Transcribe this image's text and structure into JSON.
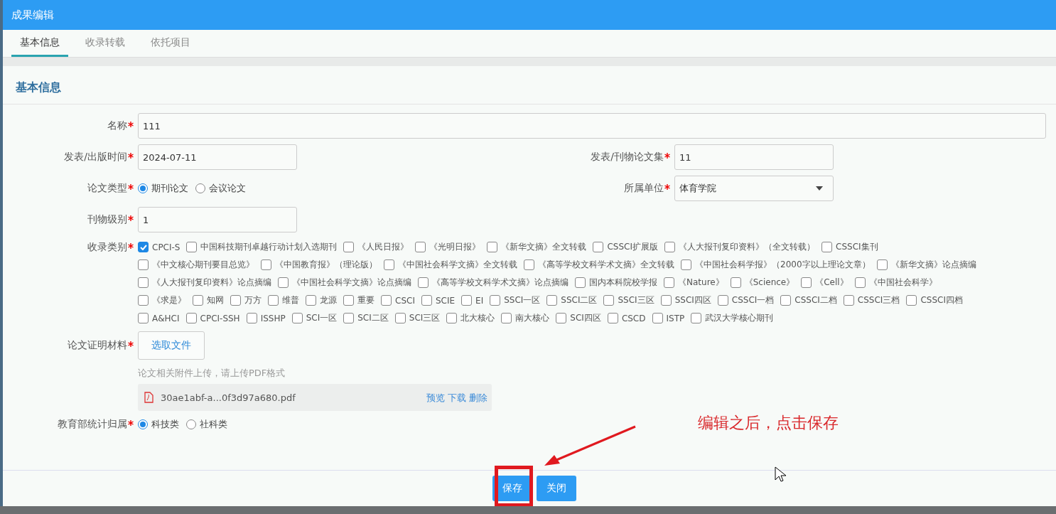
{
  "window": {
    "title": "成果编辑"
  },
  "tabs": [
    {
      "label": "基本信息",
      "selected": true
    },
    {
      "label": "收录转载",
      "selected": false
    },
    {
      "label": "依托项目",
      "selected": false
    }
  ],
  "section": {
    "title": "基本信息"
  },
  "form": {
    "name": {
      "label": "名称",
      "required": true,
      "value": "111"
    },
    "publish_date": {
      "label": "发表/出版时间",
      "required": true,
      "value": "2024-07-11"
    },
    "collection": {
      "label": "发表/刊物论文集",
      "required": true,
      "value": "11"
    },
    "paper_type": {
      "label": "论文类型",
      "required": true,
      "options": [
        {
          "label": "期刊论文",
          "selected": true
        },
        {
          "label": "会议论文",
          "selected": false
        }
      ]
    },
    "unit": {
      "label": "所属单位",
      "required": true,
      "value": "体育学院"
    },
    "journal_level": {
      "label": "刊物级别",
      "required": true,
      "value": "1"
    },
    "categories": {
      "label": "收录类别",
      "required": true,
      "options": [
        {
          "label": "CPCI-S",
          "checked": true
        },
        {
          "label": "中国科技期刊卓越行动计划入选期刊",
          "checked": false
        },
        {
          "label": "《人民日报》",
          "checked": false
        },
        {
          "label": "《光明日报》",
          "checked": false
        },
        {
          "label": "《新华文摘》全文转载",
          "checked": false
        },
        {
          "label": "CSSCI扩展版",
          "checked": false
        },
        {
          "label": "《人大报刊复印资料》（全文转载）",
          "checked": false
        },
        {
          "label": "CSSCI集刊",
          "checked": false
        },
        {
          "label": "《中文核心期刊要目总览》",
          "checked": false
        },
        {
          "label": "《中国教育报》（理论版）",
          "checked": false
        },
        {
          "label": "《中国社会科学文摘》全文转载",
          "checked": false
        },
        {
          "label": "《高等学校文科学术文摘》全文转载",
          "checked": false
        },
        {
          "label": "《中国社会科学报》（2000字以上理论文章）",
          "checked": false
        },
        {
          "label": "《新华文摘》论点摘编",
          "checked": false
        },
        {
          "label": "《人大报刊复印资料》论点摘编",
          "checked": false
        },
        {
          "label": "《中国社会科学文摘》论点摘编",
          "checked": false
        },
        {
          "label": "《高等学校文科学术文摘》论点摘编",
          "checked": false
        },
        {
          "label": "国内本科院校学报",
          "checked": false
        },
        {
          "label": "《Nature》",
          "checked": false
        },
        {
          "label": "《Science》",
          "checked": false
        },
        {
          "label": "《Cell》",
          "checked": false
        },
        {
          "label": "《中国社会科学》",
          "checked": false
        },
        {
          "label": "《求是》",
          "checked": false
        },
        {
          "label": "知网",
          "checked": false
        },
        {
          "label": "万方",
          "checked": false
        },
        {
          "label": "维普",
          "checked": false
        },
        {
          "label": "龙源",
          "checked": false
        },
        {
          "label": "重要",
          "checked": false
        },
        {
          "label": "CSCI",
          "checked": false
        },
        {
          "label": "SCIE",
          "checked": false
        },
        {
          "label": "EI",
          "checked": false
        },
        {
          "label": "SSCI一区",
          "checked": false
        },
        {
          "label": "SSCI二区",
          "checked": false
        },
        {
          "label": "SSCI三区",
          "checked": false
        },
        {
          "label": "SSCI四区",
          "checked": false
        },
        {
          "label": "CSSCI一档",
          "checked": false
        },
        {
          "label": "CSSCI二档",
          "checked": false
        },
        {
          "label": "CSSCI三档",
          "checked": false
        },
        {
          "label": "CSSCI四档",
          "checked": false
        },
        {
          "label": "A&HCI",
          "checked": false
        },
        {
          "label": "CPCI-SSH",
          "checked": false
        },
        {
          "label": "ISSHP",
          "checked": false
        },
        {
          "label": "SCI一区",
          "checked": false
        },
        {
          "label": "SCI二区",
          "checked": false
        },
        {
          "label": "SCI三区",
          "checked": false
        },
        {
          "label": "北大核心",
          "checked": false
        },
        {
          "label": "南大核心",
          "checked": false
        },
        {
          "label": "SCI四区",
          "checked": false
        },
        {
          "label": "CSCD",
          "checked": false
        },
        {
          "label": "ISTP",
          "checked": false
        },
        {
          "label": "武汉大学核心期刊",
          "checked": false
        }
      ]
    },
    "proof": {
      "label": "论文证明材料",
      "required": true,
      "button": "选取文件",
      "hint": "论文相关附件上传，请上传PDF格式",
      "file": {
        "name": "30ae1abf-a...0f3d97a680.pdf",
        "actions": [
          "预览",
          "下载",
          "删除"
        ]
      }
    },
    "moe_category": {
      "label": "教育部统计归属",
      "required": true,
      "options": [
        {
          "label": "科技类",
          "selected": true
        },
        {
          "label": "社科类",
          "selected": false
        }
      ]
    }
  },
  "buttons": {
    "save": "保存",
    "close": "关闭"
  },
  "annotation": {
    "text": "编辑之后，点击保存"
  }
}
